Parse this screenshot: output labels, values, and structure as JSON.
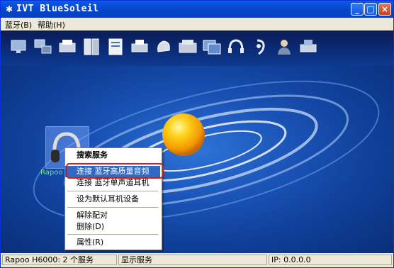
{
  "window": {
    "title": "IVT BlueSoleil"
  },
  "title_buttons": {
    "minimize": "_",
    "maximize": "□",
    "close": "×"
  },
  "menu": [
    "蓝牙(B)",
    "帮助(H)"
  ],
  "toolbar": {
    "icons": [
      "network-icon",
      "lan-icon",
      "fax-icon",
      "file-transfer-icon",
      "contacts-icon",
      "printer-icon",
      "hid-icon",
      "sync-icon",
      "image-icon",
      "headset-icon",
      "audio-icon",
      "user-icon",
      "modem-icon"
    ]
  },
  "device": {
    "label": "Rapoo"
  },
  "context_menu": {
    "items": [
      "搜索服务",
      "连接 蓝牙高质量音频",
      "连接 蓝牙单声道耳机",
      "设为默认耳机设备",
      "解除配对",
      "删除(D)",
      "属性(R)"
    ]
  },
  "status": {
    "device": "Rapoo H6000: 2 个服务",
    "show": "显示服务",
    "ip": "IP: 0.0.0.0"
  }
}
